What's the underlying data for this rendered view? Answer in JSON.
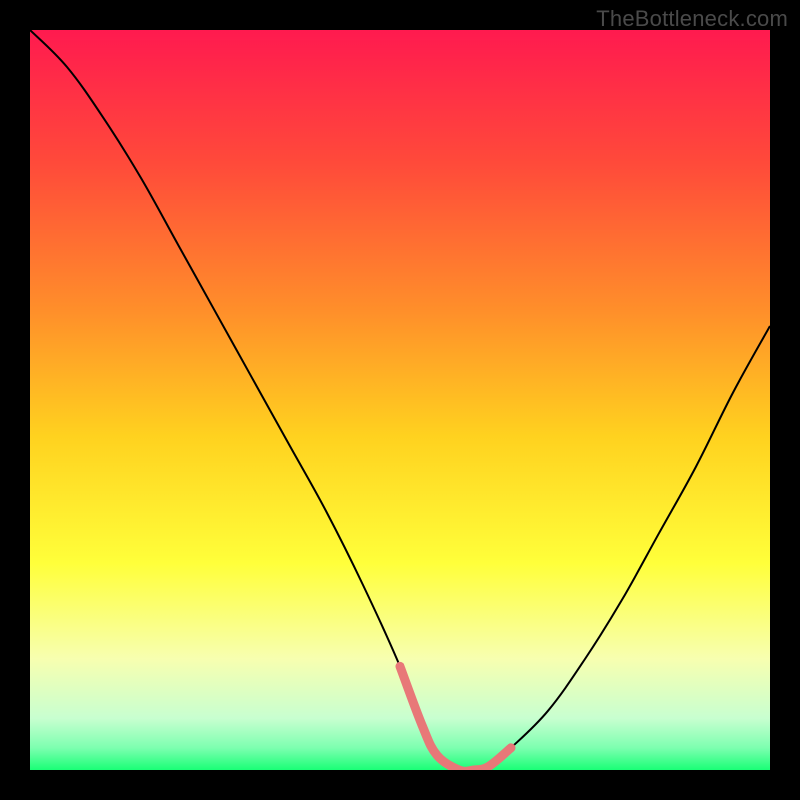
{
  "watermark": "TheBottleneck.com",
  "chart_data": {
    "type": "line",
    "title": "",
    "xlabel": "",
    "ylabel": "",
    "xlim": [
      0,
      100
    ],
    "ylim": [
      0,
      100
    ],
    "background_gradient": {
      "stops": [
        {
          "offset": 0.0,
          "color": "#ff1a4f"
        },
        {
          "offset": 0.18,
          "color": "#ff4a3a"
        },
        {
          "offset": 0.38,
          "color": "#ff8f2a"
        },
        {
          "offset": 0.55,
          "color": "#ffd21f"
        },
        {
          "offset": 0.72,
          "color": "#ffff3a"
        },
        {
          "offset": 0.85,
          "color": "#f7ffb0"
        },
        {
          "offset": 0.93,
          "color": "#c8ffd0"
        },
        {
          "offset": 0.97,
          "color": "#7dffb0"
        },
        {
          "offset": 1.0,
          "color": "#1aff76"
        }
      ]
    },
    "series": [
      {
        "name": "bottleneck-curve",
        "color": "#000000",
        "width": 2,
        "x": [
          0,
          5,
          10,
          15,
          20,
          25,
          30,
          35,
          40,
          45,
          50,
          53,
          55,
          58,
          60,
          62,
          65,
          70,
          75,
          80,
          85,
          90,
          95,
          100
        ],
        "y": [
          100,
          95,
          88,
          80,
          71,
          62,
          53,
          44,
          35,
          25,
          14,
          6,
          2,
          0,
          0,
          0.5,
          3,
          8,
          15,
          23,
          32,
          41,
          51,
          60
        ]
      },
      {
        "name": "sweet-spot-highlight",
        "color": "#e87878",
        "width": 9,
        "linecap": "round",
        "x": [
          50,
          53,
          55,
          58,
          60,
          62,
          65
        ],
        "y": [
          14,
          6,
          2,
          0,
          0,
          0.5,
          3
        ]
      }
    ]
  }
}
